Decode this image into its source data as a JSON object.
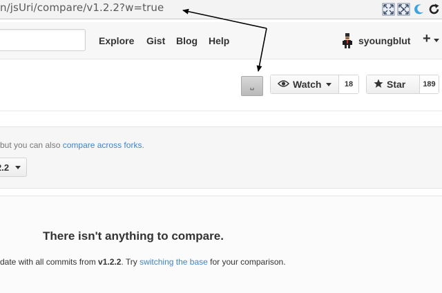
{
  "browser": {
    "url": "n/jsUri/compare/v1.2.2?w=true"
  },
  "header": {
    "nav": [
      {
        "label": "Explore"
      },
      {
        "label": "Gist"
      },
      {
        "label": "Blog"
      },
      {
        "label": "Help"
      }
    ],
    "username": "syoungblut",
    "plus": "+"
  },
  "repo": {
    "small_button_label": "␣",
    "watch_label": "Watch",
    "watch_count": "18",
    "star_label": "Star",
    "star_count": "189"
  },
  "compare": {
    "hint_prefix": "but you can also ",
    "hint_link": "compare across forks",
    "hint_suffix": ".",
    "branch_label": "2.2"
  },
  "blank_slate": {
    "title": "There isn't anything to compare.",
    "desc_prefix": "date with all commits from ",
    "desc_version": "v1.2.2",
    "desc_middle": ". Try ",
    "desc_link": "switching the base",
    "desc_suffix": " for your comparison."
  },
  "colors": {
    "link": "#4183c4",
    "text": "#333333",
    "header_bg": "#f7f7f7"
  },
  "icons": [
    "resize-icon",
    "resize-icon",
    "crescent-icon",
    "refresh-icon",
    "eye-icon",
    "star-icon",
    "avatar"
  ]
}
